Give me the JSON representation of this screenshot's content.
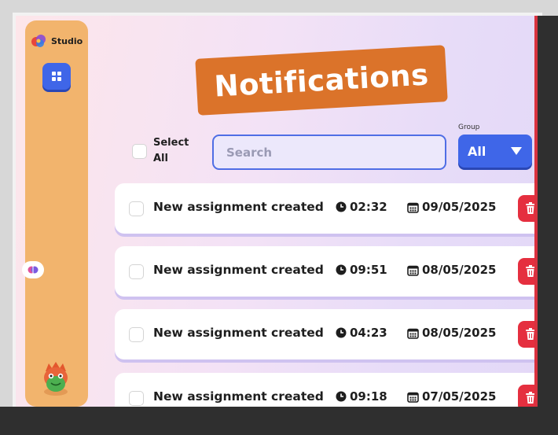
{
  "app": {
    "brand_name": "Studio"
  },
  "header": {
    "title": "Notifications",
    "banner_color": "#db732a"
  },
  "controls": {
    "select_all_label": "Select All",
    "search_placeholder": "Search",
    "search_value": "",
    "group_label": "Group",
    "group_selected": "All"
  },
  "sidebar": {
    "icons": [
      "studio-logo-icon",
      "grid-icon",
      "brain-icon",
      "dino-avatar"
    ]
  },
  "notifications": [
    {
      "title": "New assignment created",
      "time": "02:32",
      "date": "09/05/2025"
    },
    {
      "title": "New assignment created",
      "time": "09:51",
      "date": "08/05/2025"
    },
    {
      "title": "New assignment created",
      "time": "04:23",
      "date": "08/05/2025"
    },
    {
      "title": "New assignment created",
      "time": "09:18",
      "date": "07/05/2025"
    }
  ],
  "colors": {
    "accent": "#3f66e8",
    "delete": "#e52f3f",
    "sidebar": "#f2b46d"
  }
}
